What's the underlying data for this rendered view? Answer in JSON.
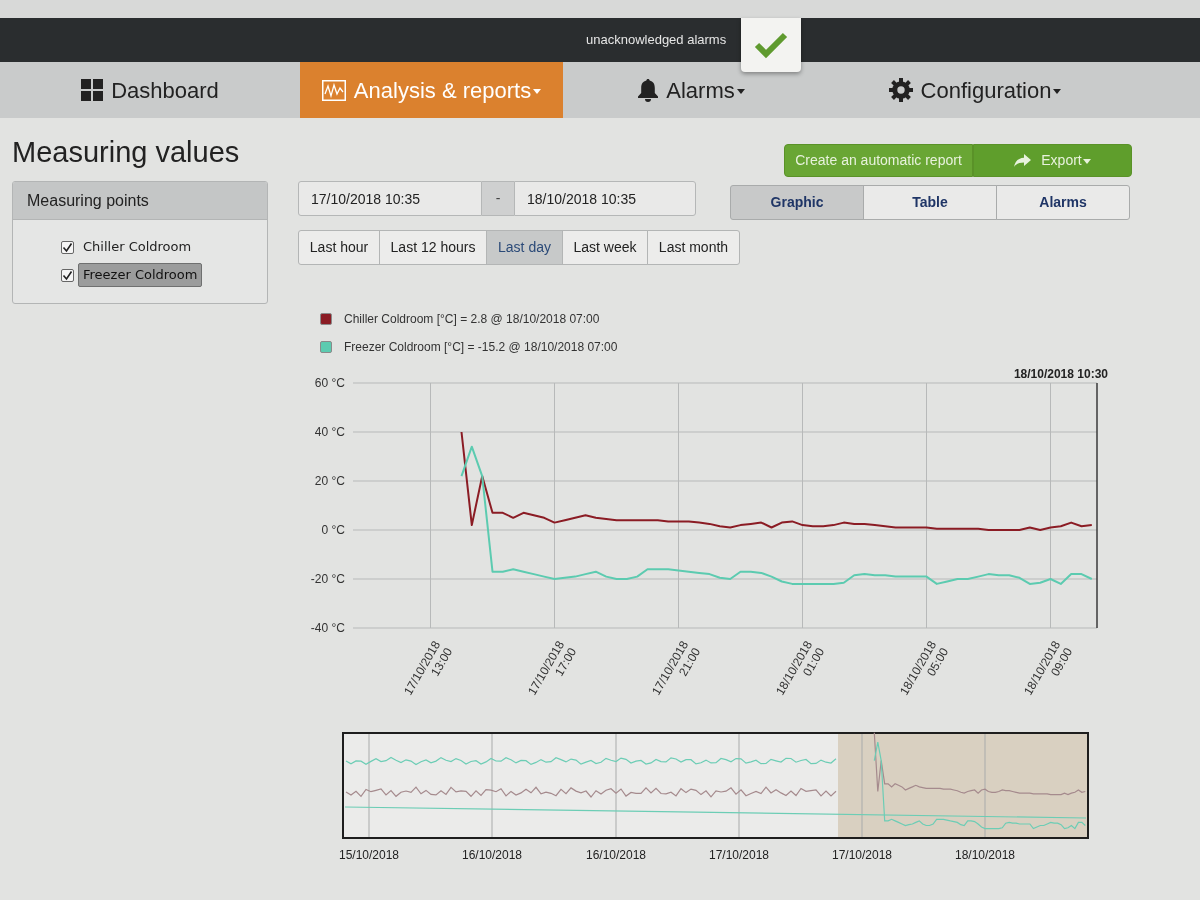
{
  "top_bar": {
    "alarm_label": "unacknowledged alarms"
  },
  "nav": [
    {
      "label": "Dashboard",
      "selected": false,
      "has_menu": false
    },
    {
      "label": "Analysis & reports",
      "selected": true,
      "has_menu": true
    },
    {
      "label": "Alarms",
      "selected": false,
      "has_menu": true
    },
    {
      "label": "Configuration",
      "selected": false,
      "has_menu": true
    }
  ],
  "page_title": "Measuring values",
  "measuring_points": {
    "title": "Measuring points",
    "items": [
      {
        "label": "Chiller Coldroom",
        "checked": true,
        "selected": false
      },
      {
        "label": "Freezer Coldroom",
        "checked": true,
        "selected": true
      }
    ]
  },
  "actions": [
    {
      "label": "Create an automatic report",
      "has_menu": false
    },
    {
      "label": "Export",
      "has_menu": true
    }
  ],
  "date_range": {
    "from": "17/10/2018 10:35",
    "separator": "-",
    "to": "18/10/2018 10:35"
  },
  "views": [
    {
      "label": "Graphic",
      "selected": true
    },
    {
      "label": "Table",
      "selected": false
    },
    {
      "label": "Alarms",
      "selected": false
    }
  ],
  "periods": [
    {
      "label": "Last hour",
      "selected": false
    },
    {
      "label": "Last 12 hours",
      "selected": false
    },
    {
      "label": "Last day",
      "selected": true
    },
    {
      "label": "Last week",
      "selected": false
    },
    {
      "label": "Last month",
      "selected": false
    }
  ],
  "chart": {
    "timestamp": "18/10/2018 10:30",
    "chart_data": {
      "type": "line",
      "legend": "top",
      "grid": true,
      "categories": [
        null,
        null,
        null,
        null,
        null,
        null,
        null,
        "17/10/2018 13:00",
        null,
        null,
        null,
        null,
        null,
        null,
        null,
        null,
        null,
        null,
        null,
        "17/10/2018 17:00",
        null,
        null,
        null,
        null,
        null,
        null,
        null,
        null,
        null,
        null,
        null,
        "17/10/2018 21:00",
        null,
        null,
        null,
        null,
        null,
        null,
        null,
        null,
        null,
        null,
        null,
        "18/10/2018 01:00",
        null,
        null,
        null,
        null,
        null,
        null,
        null,
        null,
        null,
        null,
        null,
        "18/10/2018 05:00",
        null,
        null,
        null,
        null,
        null,
        null,
        null,
        null,
        null,
        null,
        null,
        "18/10/2018 09:00",
        null,
        null,
        null,
        null
      ],
      "series": [
        {
          "name": "Chiller Coldroom [°C] = 2.8 @ 18/10/2018 07:00",
          "color": "#8b1c24",
          "values": [
            null,
            null,
            null,
            null,
            null,
            null,
            null,
            null,
            null,
            null,
            40,
            2,
            22,
            7,
            7,
            5,
            7,
            6,
            5,
            3,
            4,
            5,
            6,
            5,
            4.5,
            4,
            4,
            4,
            4,
            4,
            3.5,
            3.5,
            3.5,
            3,
            2.5,
            1.5,
            1,
            2,
            2.5,
            3,
            1,
            3,
            3.5,
            2,
            1.5,
            1.5,
            2,
            3,
            2.5,
            2.5,
            2,
            1.5,
            1,
            1,
            1,
            1,
            0.5,
            0.5,
            0.5,
            0.5,
            0.5,
            0,
            0,
            0,
            0,
            1,
            0,
            1,
            1.5,
            3,
            1.5,
            2
          ]
        },
        {
          "name": "Freezer Coldroom [°C] = -15.2 @ 18/10/2018 07:00",
          "color": "#5ccbb0",
          "values": [
            null,
            null,
            null,
            null,
            null,
            null,
            null,
            null,
            null,
            null,
            22,
            34,
            22,
            -17,
            -17,
            -16,
            -17,
            -18,
            -19,
            -20,
            -19.5,
            -19,
            -18,
            -17,
            -19,
            -20,
            -20,
            -19,
            -16,
            -16,
            -16,
            -16.5,
            -17,
            -17.5,
            -18,
            -19.5,
            -20,
            -17,
            -17,
            -17.5,
            -19,
            -21,
            -22,
            -22,
            -22,
            -22,
            -22,
            -21.5,
            -18.5,
            -18,
            -18.5,
            -18.5,
            -19,
            -19,
            -19,
            -19,
            -22,
            -21,
            -20,
            -20,
            -19,
            -18,
            -18.5,
            -18.5,
            -19.5,
            -22,
            -21.5,
            -20,
            -22,
            -18,
            -18,
            -20
          ]
        }
      ],
      "ylim": [
        -40,
        60
      ],
      "yticks": [
        {
          "value": 60,
          "label": "60 °C"
        },
        {
          "value": 40,
          "label": "40 °C"
        },
        {
          "value": 20,
          "label": "20 °C"
        },
        {
          "value": 0,
          "label": "0 °C"
        },
        {
          "value": -20,
          "label": "-20 °C"
        },
        {
          "value": -40,
          "label": "-40 °C"
        }
      ]
    }
  },
  "navigator": {
    "dates": [
      "15/10/2018",
      "16/10/2018",
      "16/10/2018",
      "17/10/2018",
      "17/10/2018",
      "18/10/2018"
    ]
  }
}
